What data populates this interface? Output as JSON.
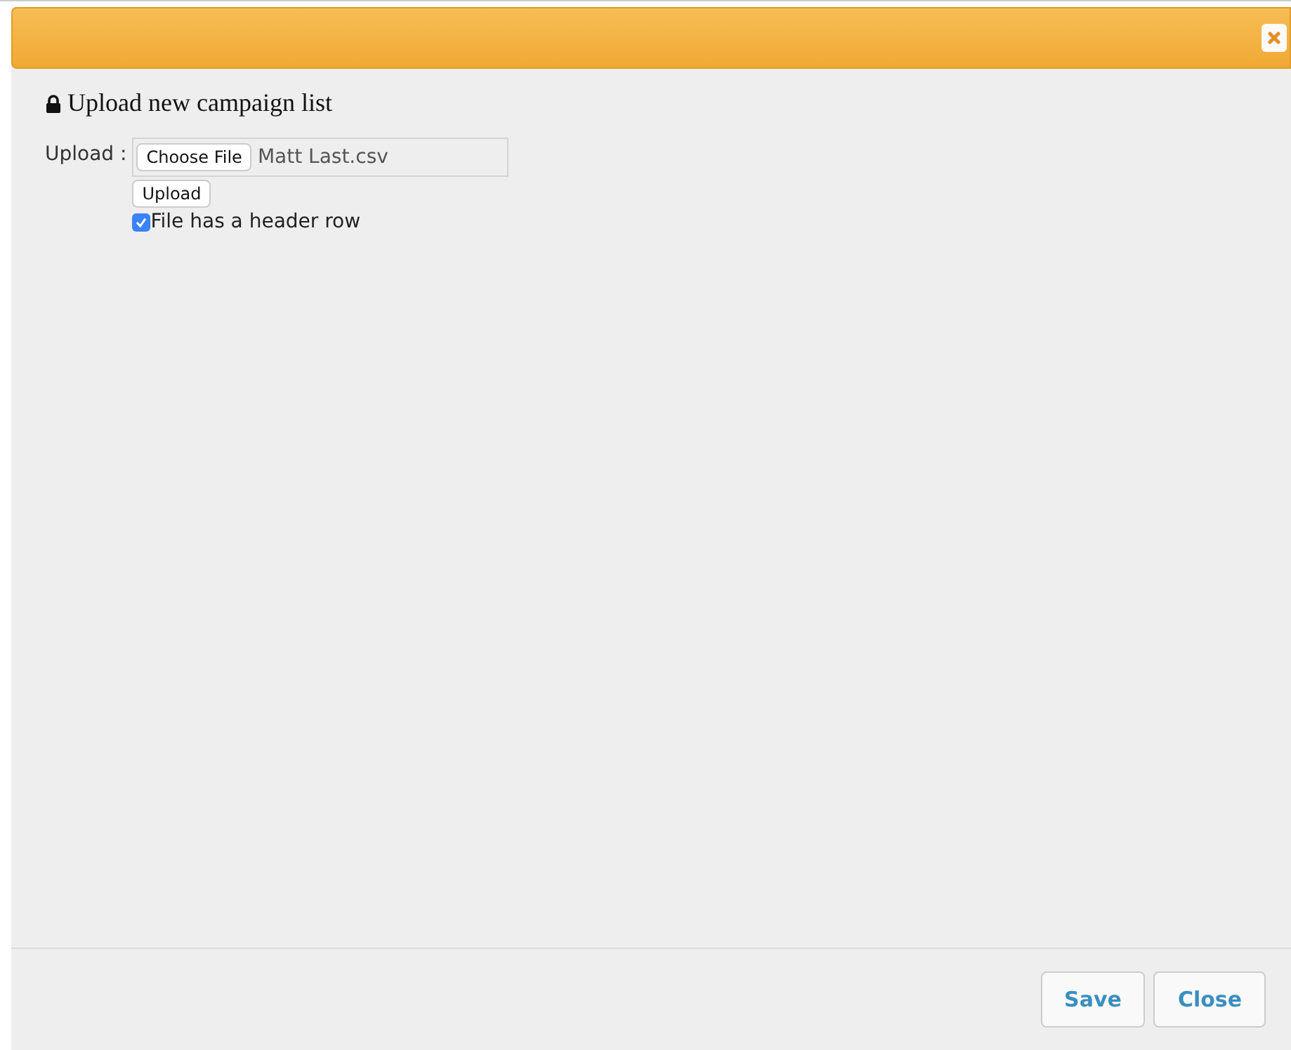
{
  "dialog": {
    "heading": "Upload new campaign list",
    "upload": {
      "label": "Upload :",
      "choose_button": "Choose File",
      "file_name": "Matt Last.csv",
      "upload_button": "Upload"
    },
    "header_row": {
      "label": "File has a header row",
      "checked": true
    },
    "buttons": [
      "Save",
      "Close"
    ]
  }
}
